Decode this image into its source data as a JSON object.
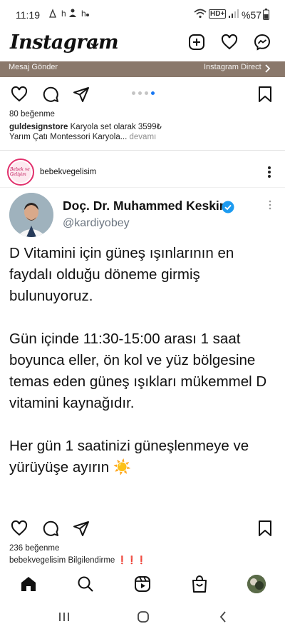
{
  "status": {
    "time": "11:19",
    "notif_letter_1": "h",
    "notif_letter_2": "h",
    "network": "HD+",
    "battery": "%57"
  },
  "header": {
    "logo": "Instagram"
  },
  "prev_post": {
    "banner_left": "Mesaj Gönder",
    "banner_right": "Instagram Direct",
    "likes": "80 beğenme",
    "caption_user": "guldesignstore",
    "caption_line1": "Karyola set olarak 3599₺",
    "caption_line2": "Yarım Çatı Montessori Karyola...",
    "more": "devamı"
  },
  "post": {
    "username": "bebekvegelisim",
    "avatar_text": "Bebek ve Gelişim",
    "likes": "236 beğenme",
    "caption_user": "bebekvegelisim",
    "caption_text": "Bilgilendirme",
    "caption_emojis": "❗❗❗"
  },
  "tweet": {
    "name": "Doç. Dr. Muhammed Keskin",
    "handle": "@kardiyobey",
    "p1": "D Vitamini için güneş ışınlarının en faydalı olduğu döneme girmiş bulunuyoruz.",
    "p2": "Gün içinde 11:30-15:00 arası 1 saat boyunca eller, ön kol ve yüz bölgesine temas eden güneş ışıkları mükemmel D vitamini kaynağıdır.",
    "p3": "Her gün 1 saatinizi güneşlenmeye ve yürüyüşe ayırın",
    "p3_emoji": "☀️"
  },
  "colors": {
    "accent_blue": "#1877f2",
    "verified_blue": "#1d9bf0",
    "banner_brown": "#8a786b"
  },
  "icons": {
    "new_post": "plus-square-icon",
    "activity": "heart-icon",
    "messenger": "messenger-icon",
    "home": "home-icon",
    "search": "search-icon",
    "reels": "reels-icon",
    "shop": "shop-icon",
    "profile": "profile-avatar"
  }
}
